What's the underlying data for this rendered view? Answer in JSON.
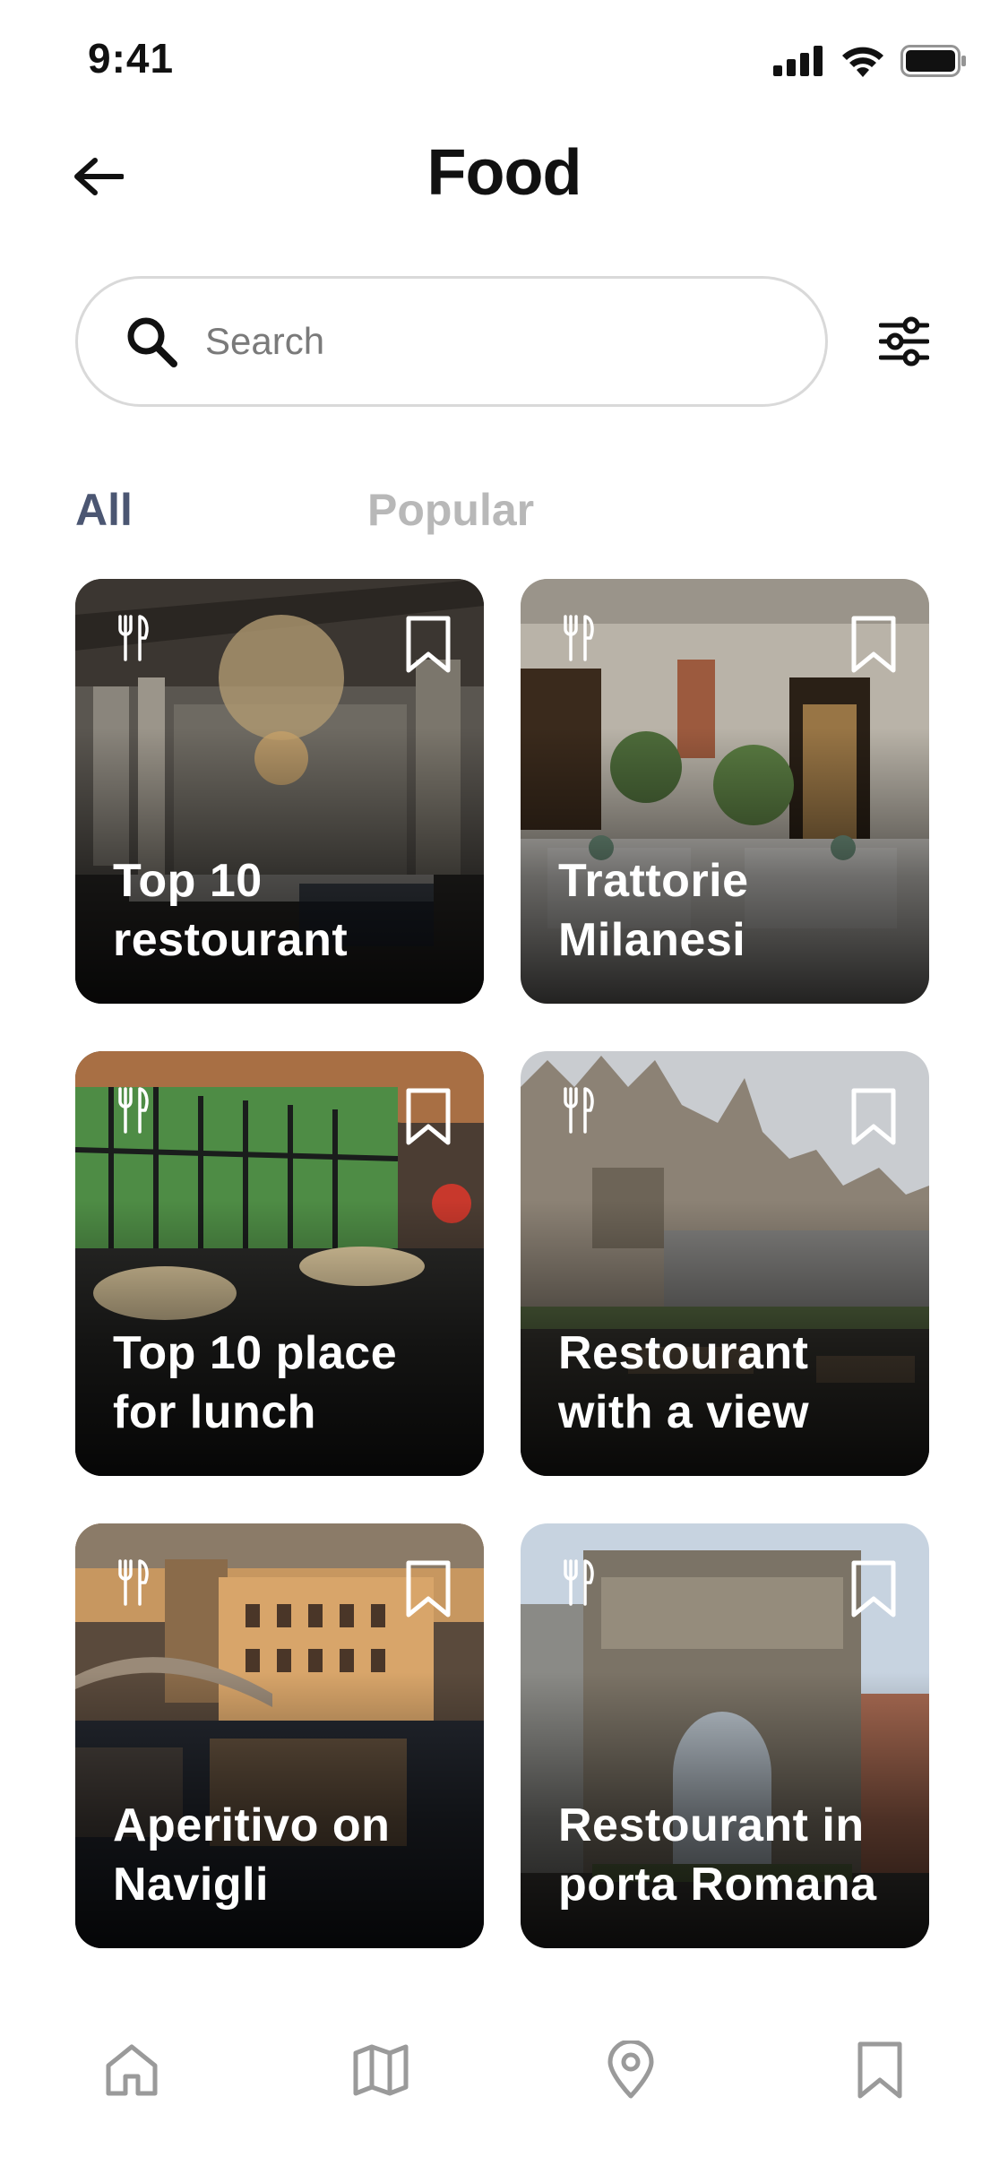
{
  "status_bar": {
    "time": "9:41"
  },
  "header": {
    "title": "Food",
    "back_icon": "arrow-left-icon"
  },
  "search": {
    "placeholder": "Search",
    "value": ""
  },
  "filter": {
    "icon": "sliders-icon"
  },
  "tabs": [
    {
      "label": "All",
      "selected": true
    },
    {
      "label": "Popular",
      "selected": false
    }
  ],
  "cards": [
    {
      "title": "Top 10\nrestourant",
      "category_icon": "fork-knife-icon",
      "bookmark_icon": "bookmark-icon"
    },
    {
      "title": "Trattorie\nMilanesi",
      "category_icon": "fork-knife-icon",
      "bookmark_icon": "bookmark-icon"
    },
    {
      "title": "Top 10 place\nfor lunch",
      "category_icon": "fork-knife-icon",
      "bookmark_icon": "bookmark-icon"
    },
    {
      "title": "Restourant\nwith a view",
      "category_icon": "fork-knife-icon",
      "bookmark_icon": "bookmark-icon"
    },
    {
      "title": "Aperitivo on\nNavigli",
      "category_icon": "fork-knife-icon",
      "bookmark_icon": "bookmark-icon"
    },
    {
      "title": "Restourant in\nporta Romana",
      "category_icon": "fork-knife-icon",
      "bookmark_icon": "bookmark-icon"
    }
  ],
  "bottom_nav": [
    {
      "icon": "home-icon"
    },
    {
      "icon": "map-icon"
    },
    {
      "icon": "location-pin-icon"
    },
    {
      "icon": "bookmark-icon"
    }
  ],
  "colors": {
    "accent_tab": "#4b5672",
    "inactive_tab": "#b8b8b8",
    "nav_icon": "#9a9a9a"
  }
}
